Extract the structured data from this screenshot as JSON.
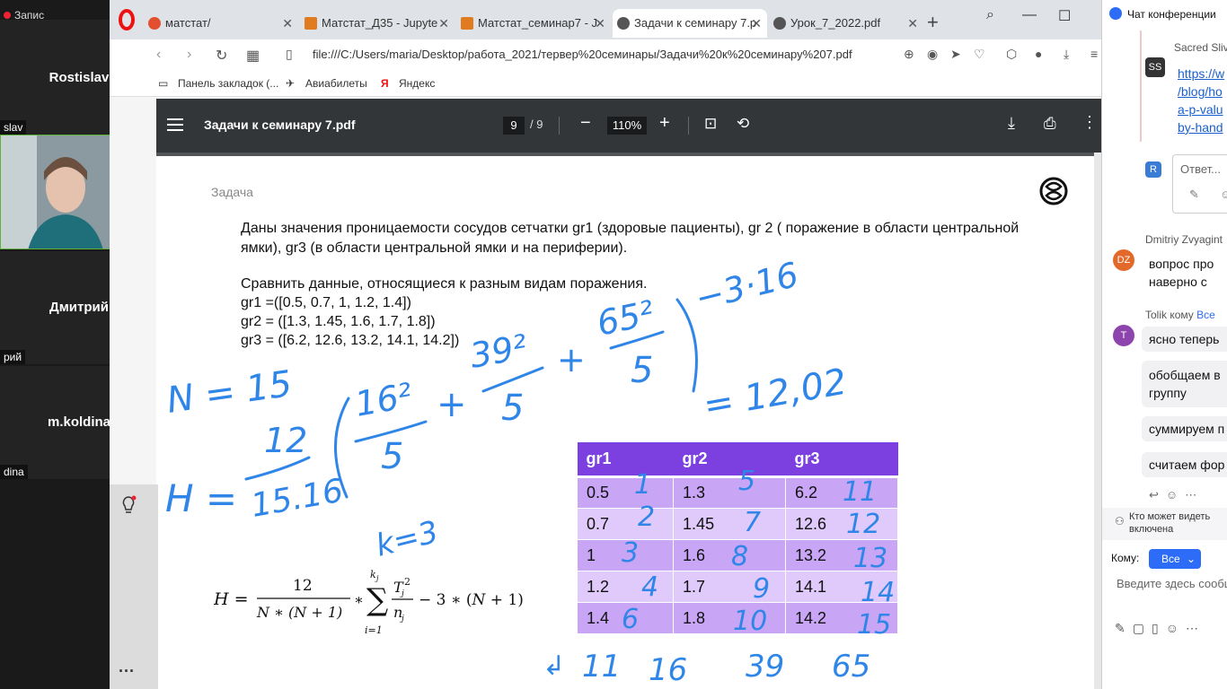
{
  "participants": {
    "recording_label": "Запис",
    "tiles": [
      {
        "name": "Rostislav",
        "tag": "slav"
      },
      {
        "name": "Дмитрий",
        "tag": "рий"
      },
      {
        "name": "m.koldina",
        "tag": "dina"
      }
    ]
  },
  "browser": {
    "tabs": [
      {
        "label": "матстат/",
        "icon_color": "#e3502f",
        "active": false
      },
      {
        "label": "Матстат_Д35 - Jupyte",
        "icon_color": "#e07b20",
        "active": false
      },
      {
        "label": "Матстат_семинар7 - J",
        "icon_color": "#e07b20",
        "active": false
      },
      {
        "label": "Задачи к семинару 7.p",
        "icon_color": "#555555",
        "active": true
      },
      {
        "label": "Урок_7_2022.pdf",
        "icon_color": "#555555",
        "active": false
      }
    ],
    "url": "file:///C:/Users/maria/Desktop/работа_2021/тервер%20семинары/Задачи%20к%20семинару%207.pdf",
    "bookmarks": [
      "Панель закладок (...",
      "Авиабилеты",
      "Яндекс"
    ]
  },
  "pdf": {
    "title": "Задачи к семинару 7.pdf",
    "page_current": "9",
    "page_total": "9",
    "zoom": "110%",
    "content": {
      "label": "Задача",
      "line1": "Даны значения проницаемости сосудов сетчатки gr1 (здоровые пациенты), gr 2 ( поражение в области центральной",
      "line2": "ямки),  gr3 (в области центральной ямки и на периферии).",
      "line3": "Сравнить данные, относящиеся к разным видам поражения.",
      "gr1": "gr1 =([0.5, 0.7, 1, 1.2, 1.4])",
      "gr2": "gr2 = ([1.3, 1.45, 1.6, 1.7, 1.8])",
      "gr3": "gr3 = ([6.2, 12.6, 13.2, 14.1, 14.2])"
    },
    "table": {
      "headers": [
        "gr1",
        "gr2",
        "gr3"
      ],
      "rows": [
        [
          "0.5",
          "1.3",
          "6.2"
        ],
        [
          "0.7",
          "1.45",
          "12.6"
        ],
        [
          "1",
          "1.6",
          "13.2"
        ],
        [
          "1.2",
          "1.7",
          "14.1"
        ],
        [
          "1.4",
          "1.8",
          "14.2"
        ]
      ]
    },
    "handwriting": {
      "n": "N = 15",
      "h_eq": "H =",
      "h_num": "12",
      "h_den": "15.16",
      "t1_num": "16²",
      "t1_den": "5",
      "t2_num": "39²",
      "t2_den": "5",
      "t3_num": "65²",
      "t3_den": "5",
      "minus": "−3·16",
      "result": "= 12,02",
      "k": "k=3",
      "ranks_gr1": [
        "1",
        "2",
        "3",
        "4",
        "6"
      ],
      "ranks_gr2": [
        "5",
        "7",
        "8",
        "9",
        "10"
      ],
      "ranks_gr3": [
        "11",
        "12",
        "13",
        "14",
        "15"
      ],
      "sums": [
        "11",
        "16",
        "39",
        "65"
      ]
    }
  },
  "chat": {
    "title": "Чат конференции",
    "messages": [
      {
        "avatar": "SS",
        "name": "Sacred Sliv",
        "link_lines": [
          "https://w",
          "/blog/ho",
          "a-p-valu",
          "by-hand"
        ]
      },
      {
        "avatar": "R",
        "reply_placeholder": "Ответ..."
      },
      {
        "avatar": "DZ",
        "name": "Dmitriy Zvyagint",
        "lines": [
          "вопрос про",
          "наверно с"
        ]
      },
      {
        "avatar": "T",
        "name": "Tolik кому",
        "name_to": "Все",
        "lines": [
          "ясно теперь",
          "обобщаем в",
          "группу",
          "суммируем п",
          "считаем фор"
        ]
      }
    ],
    "who_can_see": [
      "Кто может видеть",
      "включена"
    ],
    "to_label": "Кому:",
    "to_value": "Все",
    "input_placeholder": "Введите здесь сообщ"
  }
}
